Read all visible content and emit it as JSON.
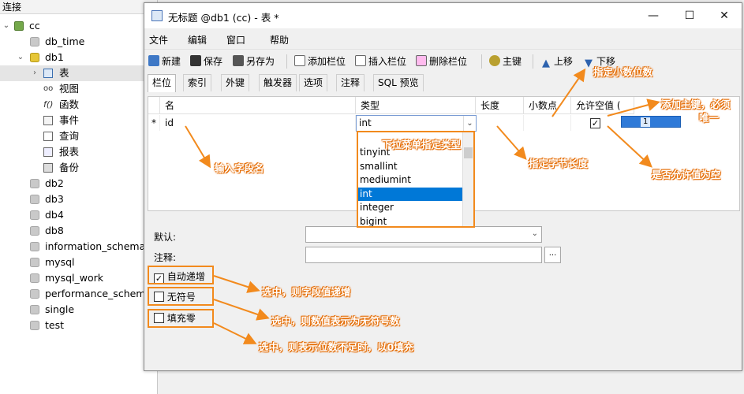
{
  "nav": {
    "title": "连接",
    "connection": "cc",
    "db_time": "db_time",
    "db1": "db1",
    "children": [
      "表",
      "视图",
      "函数",
      "事件",
      "查询",
      "报表",
      "备份"
    ],
    "databases": [
      "db2",
      "db3",
      "db4",
      "db8",
      "information_schema",
      "mysql",
      "mysql_work",
      "performance_schema",
      "single",
      "test"
    ]
  },
  "window": {
    "title": "无标题 @db1 (cc) - 表 *",
    "minimize": "—",
    "maximize": "☐",
    "close": "✕"
  },
  "menu": [
    "文件",
    "编辑",
    "窗口",
    "帮助"
  ],
  "toolbar": [
    "新建",
    "保存",
    "另存为",
    "添加栏位",
    "插入栏位",
    "删除栏位",
    "主键",
    "上移",
    "下移"
  ],
  "tabs": [
    "栏位",
    "索引",
    "外键",
    "触发器",
    "选项",
    "注释",
    "SQL 预览"
  ],
  "grid": {
    "headers": [
      "名",
      "类型",
      "长度",
      "小数点",
      "允许空值 ("
    ],
    "row": {
      "marker": "*",
      "name": "id",
      "type": "int",
      "allow_null": "✓"
    }
  },
  "type_options": [
    "tinyint",
    "smallint",
    "mediumint",
    "int",
    "integer",
    "bigint"
  ],
  "pk_popup": "1",
  "props": {
    "default_label": "默认:",
    "comment_label": "注释:",
    "ellipsis": "...",
    "auto_increment": "自动递增",
    "auto_increment_checked": "✓",
    "unsigned": "无符号",
    "zerofill": "填充零"
  },
  "annotations": {
    "decimal": "指定小数位数",
    "primary_key_1": "添加主键，必须",
    "primary_key_2": "唯一",
    "dropdown_type": "下拉菜单指定类型",
    "field_name": "输入字段名",
    "length": "指定字节长度",
    "allow_null": "是否允许值为空",
    "auto_inc": "选中，则字段值递增",
    "unsigned": "选中，则数值表示为无符号数",
    "zerofill": "选中，则表示位数不足时，以0填充"
  },
  "colors": {
    "annotation": "#f28a1d",
    "selection": "#0078d7"
  }
}
